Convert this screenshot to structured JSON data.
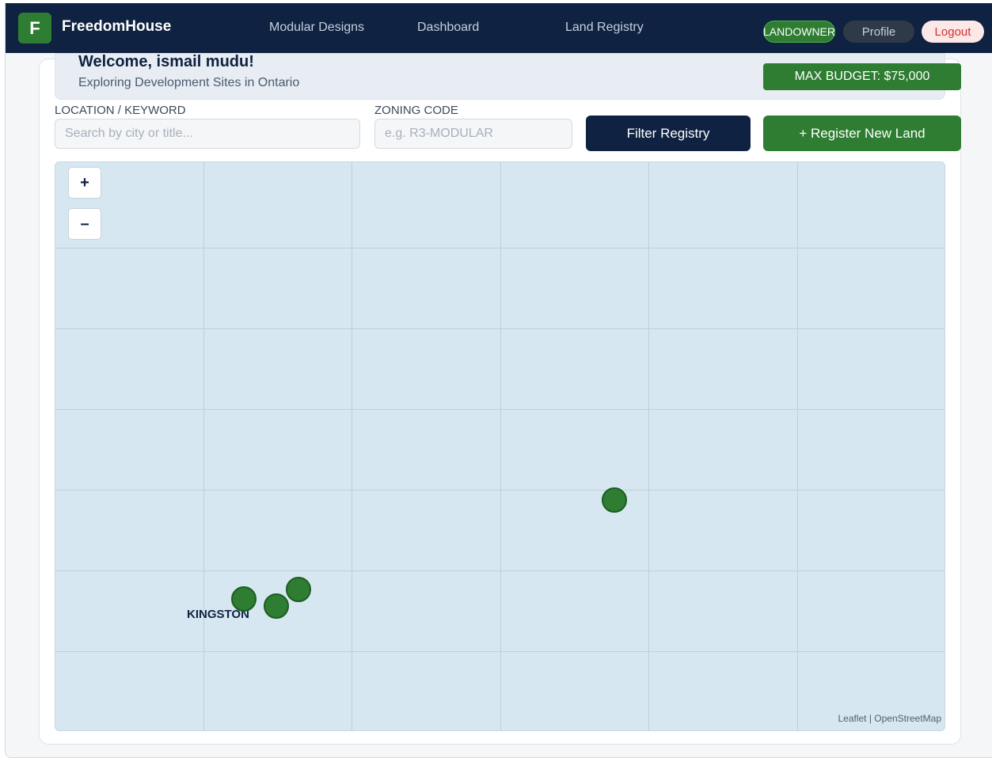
{
  "nav": {
    "logo_letter": "F",
    "brand": "FreedomHouse",
    "links": [
      "Modular Designs",
      "Dashboard",
      "Land Registry"
    ],
    "role_badge": "LANDOWNER",
    "profile_label": "Profile",
    "logout_label": "Logout"
  },
  "welcome": {
    "title": "Welcome, ismail mudu!",
    "subtitle": "Exploring Development Sites in Ontario",
    "budget": "MAX BUDGET: $75,000"
  },
  "filters": {
    "location_label": "LOCATION / KEYWORD",
    "location_placeholder": "Search by city or title...",
    "location_value": "",
    "zoning_label": "ZONING CODE",
    "zoning_placeholder": "e.g. R3-MODULAR",
    "zoning_value": "",
    "filter_button": "Filter Registry",
    "register_button": "+ Register New Land"
  },
  "map": {
    "zoom_in": "+",
    "zoom_out": "–",
    "place_label": "KINGSTON",
    "attribution": "Leaflet | OpenStreetMap",
    "marker_color": "#2e7d32",
    "marker_count": 4
  },
  "colors": {
    "navy": "#0f2241",
    "green": "#2e7d32",
    "logout_red": "#d32f2f",
    "map_water": "#d6e7f1"
  }
}
